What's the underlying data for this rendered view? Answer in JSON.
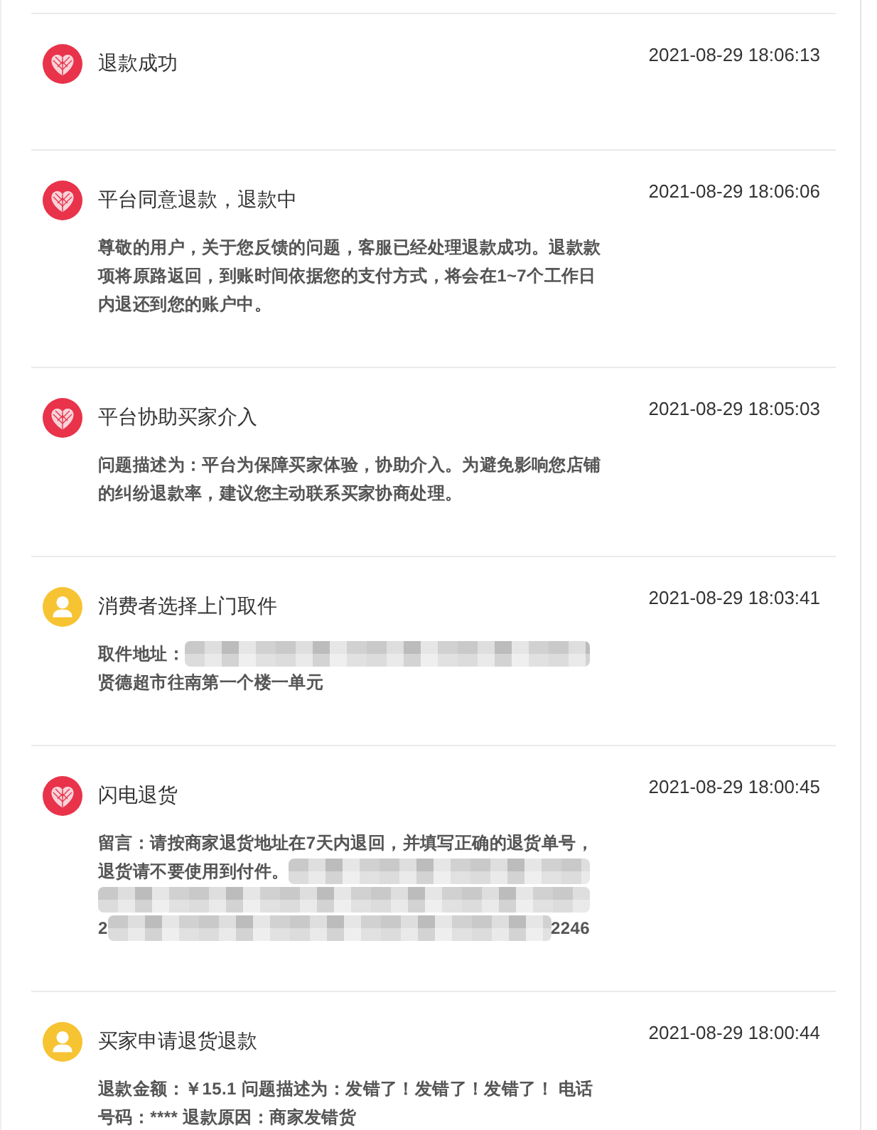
{
  "events": [
    {
      "kind": "platform",
      "title": "退款成功",
      "time": "2021-08-29 18:06:13"
    },
    {
      "kind": "platform",
      "title": "平台同意退款，退款中",
      "time": "2021-08-29 18:06:06",
      "body": "尊敬的用户，关于您反馈的问题，客服已经处理退款成功。退款款项将原路返回，到账时间依据您的支付方式，将会在1~7个工作日内退还到您的账户中。"
    },
    {
      "kind": "platform",
      "title": "平台协助买家介入",
      "time": "2021-08-29 18:05:03",
      "body": "问题描述为：平台为保障买家体验，协助介入。为避免影响您店铺的纠纷退款率，建议您主动联系买家协商处理。"
    },
    {
      "kind": "buyer",
      "title": "消费者选择上门取件",
      "time": "2021-08-29 18:03:41",
      "body_lines": [
        [
          {
            "kind": "text",
            "text": "取件地址："
          },
          {
            "kind": "redacted"
          }
        ],
        [
          {
            "kind": "text",
            "text": "贤德超市往南第一个楼一单元"
          }
        ]
      ]
    },
    {
      "kind": "platform",
      "title": "闪电退货",
      "time": "2021-08-29 18:00:45",
      "body_lines": [
        [
          {
            "kind": "text",
            "text": "留言：请按商家退货地址在7天内退回，并填写正确的退货单号，"
          }
        ],
        [
          {
            "kind": "text",
            "text": "退货请不要使用到付件。"
          },
          {
            "kind": "redacted"
          }
        ],
        [
          {
            "kind": "redacted"
          }
        ],
        [
          {
            "kind": "text",
            "text": "2"
          },
          {
            "kind": "redacted"
          },
          {
            "kind": "text",
            "text": "2246"
          }
        ]
      ]
    },
    {
      "kind": "buyer",
      "title": "买家申请退货退款",
      "time": "2021-08-29 18:00:44",
      "body": "退款金额：￥15.1 问题描述为：发错了！发错了！发错了！ 电话号码：**** 退款原因：商家发错货"
    }
  ]
}
